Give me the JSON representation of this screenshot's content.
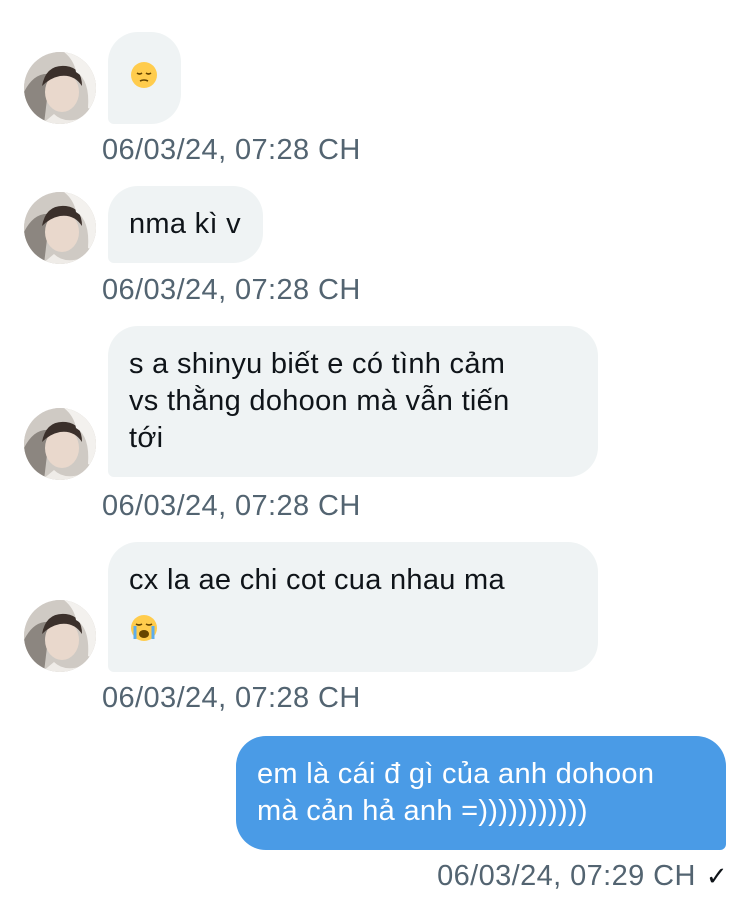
{
  "messages": [
    {
      "direction": "in",
      "emoji": "pensive-face-emoji",
      "lines": [],
      "timestamp": "06/03/24, 07:28 CH"
    },
    {
      "direction": "in",
      "lines": [
        "nma kì v"
      ],
      "timestamp": "06/03/24, 07:28 CH"
    },
    {
      "direction": "in",
      "lines": [
        "s a shinyu biết e có tình cảm",
        "vs thằng dohoon mà vẫn tiến",
        "tới"
      ],
      "timestamp": "06/03/24, 07:28 CH"
    },
    {
      "direction": "in",
      "lines": [
        "cx la ae chi cot cua nhau ma"
      ],
      "emoji": "loudly-crying-face-emoji",
      "timestamp": "06/03/24, 07:28 CH"
    },
    {
      "direction": "out",
      "lines": [
        "em là cái đ gì của anh dohoon",
        "mà cản hả anh =)))))))))))"
      ],
      "timestamp": "06/03/24, 07:29 CH",
      "status": "✓"
    }
  ],
  "colors": {
    "incoming_bubble": "#eff3f4",
    "outgoing_bubble": "#4a9be6",
    "timestamp": "#536471"
  }
}
